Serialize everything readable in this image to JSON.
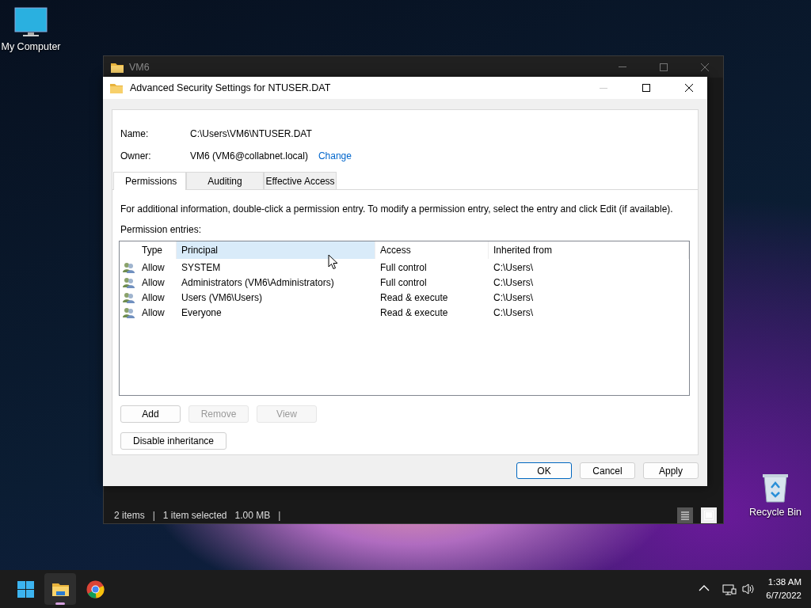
{
  "desktop_icons": [
    {
      "kind": "computer",
      "label": "My Computer"
    },
    {
      "kind": "recycle",
      "label": "Recycle Bin"
    }
  ],
  "explorer": {
    "title": "VM6",
    "status_items": [
      {
        "kind": "text",
        "text": "2 items"
      },
      {
        "kind": "separator",
        "text": "|"
      },
      {
        "kind": "text",
        "text": "1 item selected"
      },
      {
        "kind": "text",
        "text": "1.00 MB"
      },
      {
        "kind": "separator",
        "text": "|"
      }
    ],
    "view_buttons": [
      {
        "kind": "details",
        "selected": true
      },
      {
        "kind": "tiles",
        "selected": false
      }
    ]
  },
  "dialog": {
    "title": "Advanced Security Settings for NTUSER.DAT",
    "fields": [
      {
        "label": "Name:",
        "value": "C:\\Users\\VM6\\NTUSER.DAT"
      },
      {
        "label": "Owner:",
        "value": "VM6 (VM6@collabnet.local)",
        "link": "Change"
      }
    ],
    "tabs": [
      {
        "label": "Permissions",
        "selected": true
      },
      {
        "label": "Auditing",
        "selected": false
      },
      {
        "label": "Effective Access",
        "selected": false
      }
    ],
    "info": "For additional information, double-click a permission entry. To modify a permission entry, select the entry and click Edit (if available).",
    "entries_label": "Permission entries:",
    "table": {
      "columns": [
        {
          "label": "Type",
          "hovered": false
        },
        {
          "label": "Principal",
          "hovered": true
        },
        {
          "label": "Access",
          "hovered": false
        },
        {
          "label": "Inherited from",
          "hovered": false
        }
      ],
      "rows": [
        [
          "Allow",
          "SYSTEM",
          "Full control",
          "C:\\Users\\"
        ],
        [
          "Allow",
          "Administrators (VM6\\Administrators)",
          "Full control",
          "C:\\Users\\"
        ],
        [
          "Allow",
          "Users (VM6\\Users)",
          "Read & execute",
          "C:\\Users\\"
        ],
        [
          "Allow",
          "Everyone",
          "Read & execute",
          "C:\\Users\\"
        ]
      ]
    },
    "entry_buttons": [
      {
        "label": "Add",
        "disabled": false
      },
      {
        "label": "Remove",
        "disabled": true
      },
      {
        "label": "View",
        "disabled": true
      }
    ],
    "inheritance_button": "Disable inheritance",
    "buttons": [
      {
        "label": "OK",
        "default": true
      },
      {
        "label": "Cancel",
        "default": false
      },
      {
        "label": "Apply",
        "default": false
      }
    ]
  },
  "taskbar": {
    "apps": [
      {
        "kind": "start",
        "running": false
      },
      {
        "kind": "explorer",
        "running": true
      },
      {
        "kind": "chrome",
        "running": false
      }
    ],
    "time": "1:38 AM",
    "date": "6/7/2022"
  }
}
